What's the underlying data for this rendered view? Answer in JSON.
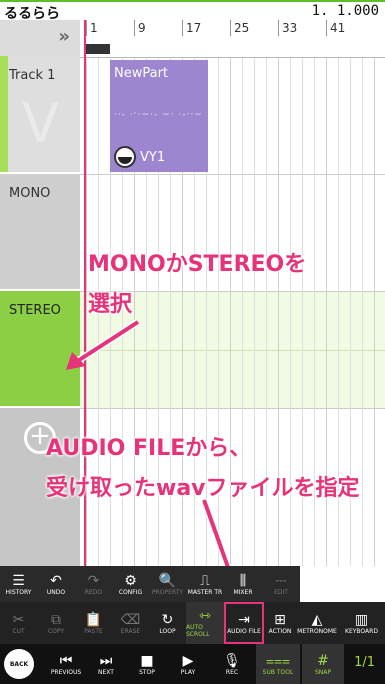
{
  "header": {
    "song_title": "るるらら",
    "position": "1. 1.000"
  },
  "ruler": {
    "collapse_icon": "»",
    "ticks": [
      "1",
      "9",
      "17",
      "25",
      "33",
      "41"
    ]
  },
  "tracks": [
    {
      "label": "Track 1"
    },
    {
      "label": "MONO"
    },
    {
      "label": "STEREO"
    }
  ],
  "part": {
    "name": "NewPart",
    "notes": "··- ·ˑ·~·- ~·  ·-··~",
    "voice": "VY1"
  },
  "add_track_icon": "+",
  "annotations": {
    "line1": "MONOかSTEREOを",
    "line2": "選択",
    "line3": "AUDIO FILEから、",
    "line4": "受け取ったwavファイルを指定"
  },
  "toolbar_top": [
    {
      "icon": "☰",
      "label": "HISTORY"
    },
    {
      "icon": "↶",
      "label": "UNDO"
    },
    {
      "icon": "↷",
      "label": "REDO"
    },
    {
      "icon": "⚙",
      "label": "CONFIG"
    },
    {
      "icon": "🔍",
      "label": "PROPERTY"
    },
    {
      "icon": "⎍",
      "label": "MASTER TR"
    },
    {
      "icon": "⫼",
      "label": "MIXER"
    },
    {
      "icon": "⎓",
      "label": "EDIT"
    }
  ],
  "toolbar_mid": [
    {
      "icon": "✂",
      "label": "CUT"
    },
    {
      "icon": "⧉",
      "label": "COPY"
    },
    {
      "icon": "📋",
      "label": "PASTE"
    },
    {
      "icon": "⌫",
      "label": "ERASE"
    },
    {
      "icon": "↻",
      "label": "LOOP"
    },
    {
      "icon": "⇿",
      "label": "AUTO SCROLL"
    },
    {
      "icon": "⇥",
      "label": "AUDIO FILE"
    },
    {
      "icon": "⊞",
      "label": "ACTION"
    },
    {
      "icon": "◭",
      "label": "METRONOME"
    },
    {
      "icon": "▥",
      "label": "KEYBOARD"
    }
  ],
  "toolbar_bot": [
    {
      "icon": "◀",
      "label": "BACK"
    },
    {
      "icon": "⏮",
      "label": "PREVIOUS"
    },
    {
      "icon": "⏭",
      "label": "NEXT"
    },
    {
      "icon": "■",
      "label": "STOP"
    },
    {
      "icon": "▶",
      "label": "PLAY"
    },
    {
      "icon": "🎙",
      "label": "REC"
    },
    {
      "icon": "⩶",
      "label": "SUB TOOL"
    },
    {
      "icon": "#",
      "label": "SNAP"
    }
  ],
  "page_indicator": "1/1",
  "colors": {
    "accent": "#9dd74a",
    "annotation": "#e6337a",
    "part": "#9b86cf"
  }
}
